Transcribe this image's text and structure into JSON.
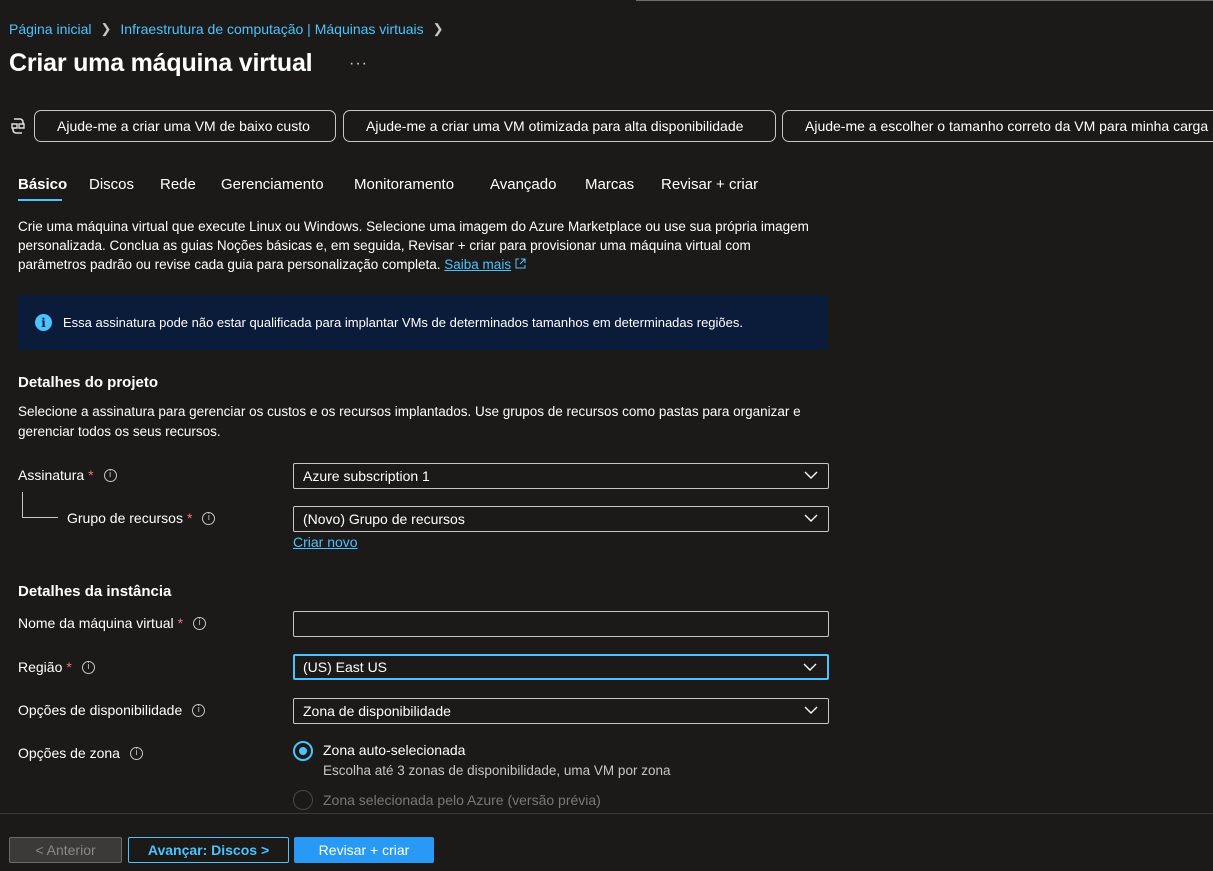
{
  "breadcrumb": {
    "home": "Página inicial",
    "section": "Infraestrutura de computação | Máquinas virtuais"
  },
  "page": {
    "title": "Criar uma máquina virtual",
    "more": "···"
  },
  "copilot_prompts": [
    "Ajude-me a criar uma VM de baixo custo",
    "Ajude-me a criar uma VM otimizada para alta disponibilidade",
    "Ajude-me a escolher o tamanho correto da VM para minha carga"
  ],
  "tabs": [
    "Básico",
    "Discos",
    "Rede",
    "Gerenciamento",
    "Monitoramento",
    "Avançado",
    "Marcas",
    "Revisar + criar"
  ],
  "active_tab": "Básico",
  "intro": {
    "text": "Crie uma máquina virtual que execute Linux ou Windows. Selecione uma imagem do Azure Marketplace ou use sua própria imagem personalizada. Conclua as guias Noções básicas e, em seguida, Revisar + criar para provisionar uma máquina virtual com parâmetros padrão ou revise cada guia para personalização completa.",
    "learn_more": "Saiba mais"
  },
  "banner": {
    "text": "Essa assinatura pode não estar qualificada para implantar VMs de determinados tamanhos em determinadas regiões."
  },
  "project": {
    "title": "Detalhes do projeto",
    "description": "Selecione a assinatura para gerenciar os custos e os recursos implantados. Use grupos de recursos como pastas para organizar e gerenciar todos os seus recursos.",
    "subscription_label": "Assinatura",
    "subscription_value": "Azure subscription 1",
    "resource_group_label": "Grupo de recursos",
    "resource_group_value": "(Novo) Grupo de recursos",
    "create_new": "Criar novo"
  },
  "instance": {
    "title": "Detalhes da instância",
    "vm_name_label": "Nome da máquina virtual",
    "vm_name_value": "",
    "region_label": "Região",
    "region_value": "(US) East US",
    "availability_label": "Opções de disponibilidade",
    "availability_value": "Zona de disponibilidade",
    "zone_label": "Opções de zona",
    "zone_options": [
      {
        "label": "Zona auto-selecionada",
        "description": "Escolha até 3 zonas de disponibilidade, uma VM por zona",
        "selected": true
      },
      {
        "label": "Zona selecionada pelo Azure (versão prévia)",
        "selected": false,
        "disabled": true
      }
    ]
  },
  "required_marker": "*",
  "info_glyph": "i",
  "footer": {
    "previous": "< Anterior",
    "next": "Avançar: Discos >",
    "review": "Revisar + criar"
  },
  "colors": {
    "background": "#1b1a19",
    "accent": "#4cc2ff",
    "primary_button": "#2899f5",
    "banner": "#0b1b3a",
    "required": "#f1707b"
  }
}
